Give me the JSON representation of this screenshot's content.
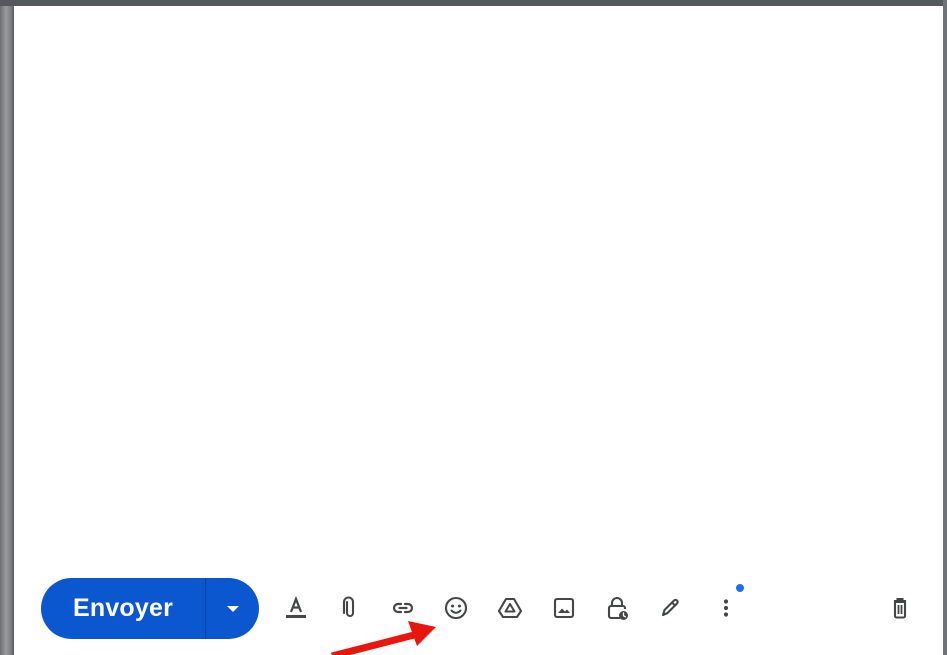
{
  "compose": {
    "send_label": "Envoyer",
    "send_options_icon": "arrow-drop-down-icon",
    "toolbar_icons": [
      "text-format-icon",
      "attach-icon",
      "link-icon",
      "emoji-icon",
      "drive-icon",
      "photo-icon",
      "confidential-mode-icon",
      "signature-icon",
      "more-options-icon",
      "delete-icon"
    ]
  },
  "annotation": {
    "arrow_color": "#e8160c"
  },
  "colors": {
    "send_button": "#0b57d0",
    "icon": "#444746",
    "notification_dot": "#1a73e8"
  }
}
